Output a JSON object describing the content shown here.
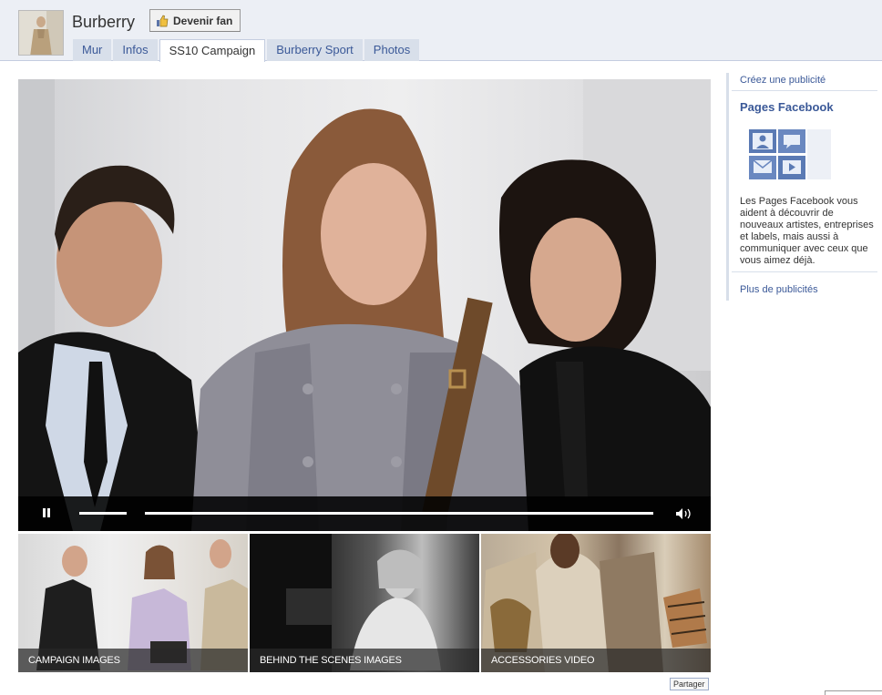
{
  "header": {
    "page_name": "Burberry",
    "fan_button_label": "Devenir fan",
    "tabs": [
      {
        "label": "Mur"
      },
      {
        "label": "Infos"
      },
      {
        "label": "SS10 Campaign"
      },
      {
        "label": "Burberry Sport"
      },
      {
        "label": "Photos"
      }
    ],
    "active_tab": "SS10 Campaign"
  },
  "video": {
    "controls": {
      "pause_icon": "pause-icon",
      "volume_icon": "speaker-icon"
    }
  },
  "thumbnails": [
    {
      "caption": "CAMPAIGN IMAGES"
    },
    {
      "caption": "BEHIND THE SCENES IMAGES"
    },
    {
      "caption": "ACCESSORIES VIDEO"
    }
  ],
  "share_label": "Partager",
  "sidebar": {
    "create_ad": "Créez une publicité",
    "pages_title": "Pages Facebook",
    "pages_description": "Les Pages Facebook vous aident à découvrir de nouveaux artistes, entreprises et labels, mais aussi à communiquer avec ceux que vous aimez déjà.",
    "more_ads": "Plus de publicités"
  },
  "colors": {
    "link": "#3b5998",
    "header_bg": "#eceff5",
    "tab_bg": "#d8dfea"
  }
}
